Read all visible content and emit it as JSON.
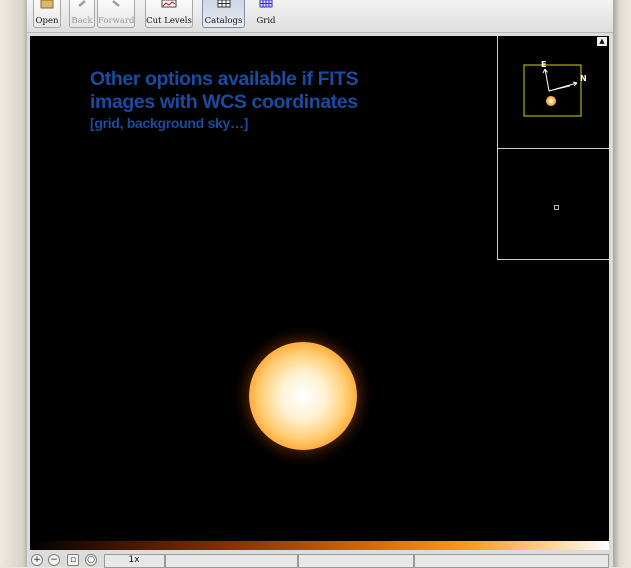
{
  "toolbar": {
    "open": "Open",
    "back": "Back",
    "forward": "Forward",
    "cut_levels": "Cut Levels",
    "catalogs": "Catalogs",
    "grid": "Grid"
  },
  "overlay": {
    "line1": "Other options available if FITS",
    "line2": "images with WCS coordinates",
    "line3": "[grid, background sky…]"
  },
  "compass": {
    "east": "E",
    "north": "N"
  },
  "status": {
    "zoom": "1x"
  },
  "colors": {
    "annotation": "#1b4aa0",
    "pan_box": "#d4d400",
    "star_core": "#ffffff",
    "star_edge": "#e06606",
    "background": "#010101"
  }
}
